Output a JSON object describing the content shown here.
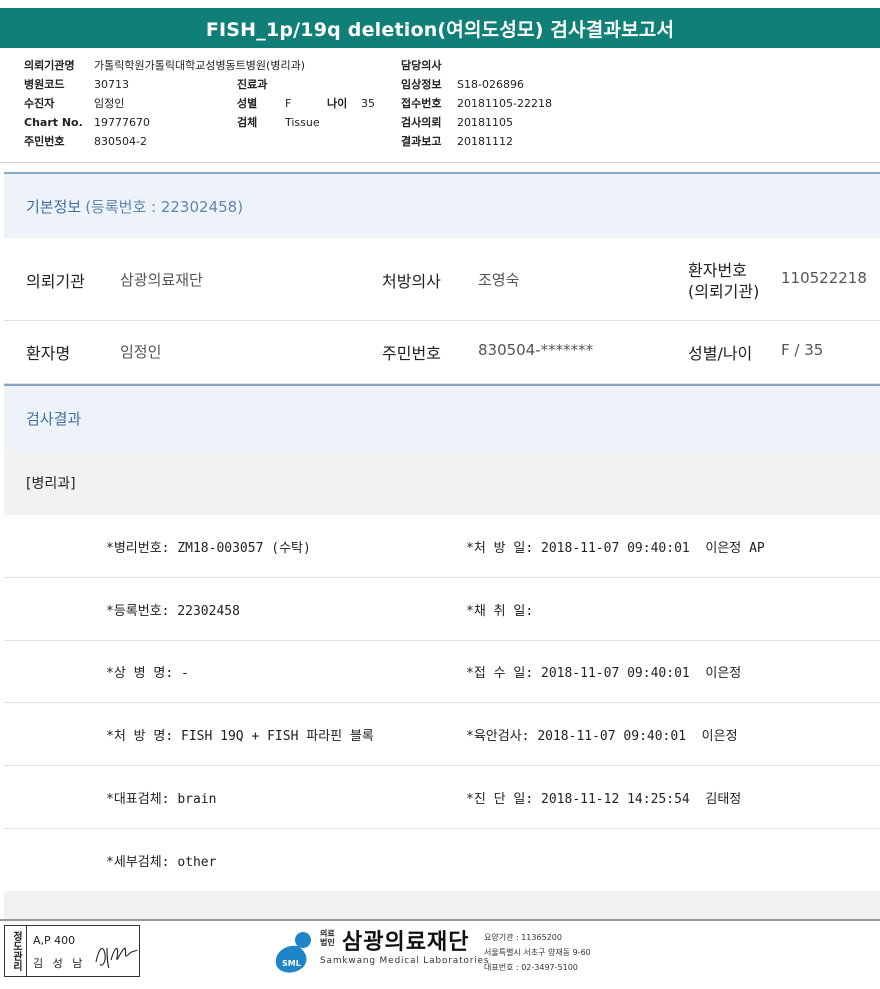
{
  "title": "FISH_1p/19q deletion(여의도성모) 검사결과보고서",
  "header": {
    "col1": [
      {
        "label": "의뢰기관명",
        "value": "가톨릭학원가톨릭대학교성병동트병원(병리과)"
      },
      {
        "label": "병원코드",
        "value": "30713"
      },
      {
        "label": "수진자",
        "value": "임정인"
      },
      {
        "label": "Chart No.",
        "value": "19777670"
      },
      {
        "label": "주민번호",
        "value": "830504-2"
      }
    ],
    "col2": [
      {
        "label": "진료과",
        "value": ""
      },
      {
        "label": "성별",
        "value": "F"
      },
      {
        "label": "검체",
        "value": "Tissue"
      }
    ],
    "age_label": "나이",
    "age_value": "35",
    "col3": [
      {
        "label": "담당의사",
        "value": ""
      },
      {
        "label": "임상정보",
        "value": "S18-026896"
      },
      {
        "label": "접수번호",
        "value": "20181105-22218"
      },
      {
        "label": "검사의뢰",
        "value": "20181105"
      },
      {
        "label": "결과보고",
        "value": "20181112"
      }
    ]
  },
  "basic_info": {
    "heading": "기본정보",
    "heading_sub": "(등록번호 : 22302458)",
    "row1": {
      "inst_label": "의뢰기관",
      "inst_value": "삼광의료재단",
      "doctor_label": "처방의사",
      "doctor_value": "조영숙",
      "patno_label_1": "환자번호",
      "patno_label_2": "(의뢰기관)",
      "patno_value": "110522218"
    },
    "row2": {
      "name_label": "환자명",
      "name_value": "임정인",
      "rrn_label": "주민번호",
      "rrn_value": "830504-*******",
      "sexage_label": "성별/나이",
      "sexage_value": "F / 35"
    }
  },
  "results": {
    "heading": "검사결과",
    "dept": "[병리과]",
    "rows": [
      {
        "left": "*병리번호: ZM18-003057 (수탁)",
        "right": "*처 방 일: 2018-11-07 09:40:01  이은정 AP"
      },
      {
        "left": "*등록번호: 22302458",
        "right": "*채 취 일:"
      },
      {
        "left": "*상 병 명: -",
        "right": "*접 수 일: 2018-11-07 09:40:01  이은정"
      },
      {
        "left": "*처 방 명: FISH 19Q + FISH 파라핀 블록",
        "right": "*육안검사: 2018-11-07 09:40:01  이은정"
      },
      {
        "left": "*대표검체: brain",
        "right": "*진 단 일: 2018-11-12 14:25:54  김태정"
      },
      {
        "left": "*세부검체: other",
        "right": ""
      }
    ]
  },
  "footer": {
    "stamp_side": "정도관리",
    "stamp_line1": "A,P 400",
    "stamp_line2": "김 성 남",
    "logo_small": "의료\n법인",
    "logo_name": "삼광의료재단",
    "logo_en": "Samkwang Medical Laboratories",
    "logo_badge": "SML",
    "info1": "요양기관 : 11365200",
    "info2": "서울특별시 서초구 양재동 9-60",
    "info3": "대표번호 : 02-3497-5100"
  },
  "colors": {
    "title_bg": "#0f7f78",
    "section_bg": "#eef3f9",
    "section_text": "#3d6e9f",
    "logo_blue": "#1e86c8"
  }
}
